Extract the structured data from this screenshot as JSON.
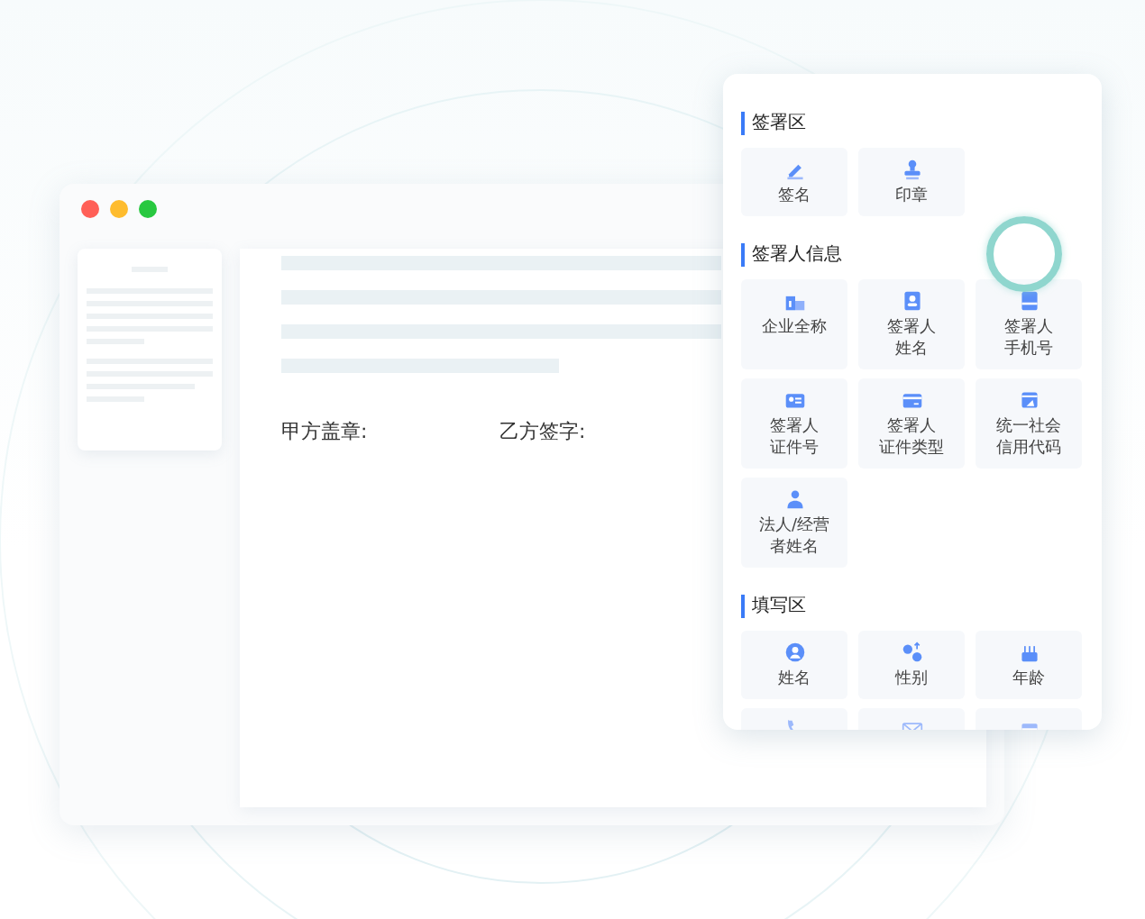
{
  "document": {
    "signature_fields": [
      {
        "label": "甲方盖章:"
      },
      {
        "label": "乙方签字:"
      }
    ]
  },
  "panel": {
    "sections": [
      {
        "title": "签署区",
        "items": [
          {
            "kind": "tile",
            "label": "签名"
          },
          {
            "kind": "tile",
            "label": "印章"
          }
        ]
      },
      {
        "title": "签署人信息",
        "items": [
          {
            "kind": "tile",
            "label": "企业全称"
          },
          {
            "kind": "tile",
            "lines": [
              "签署人",
              "姓名"
            ]
          },
          {
            "kind": "tile",
            "lines": [
              "签署人",
              "手机号"
            ]
          },
          {
            "kind": "tile",
            "lines": [
              "签署人",
              "证件号"
            ]
          },
          {
            "kind": "tile",
            "lines": [
              "签署人",
              "证件类型"
            ]
          },
          {
            "kind": "tile",
            "lines": [
              "统一社会",
              "信用代码"
            ]
          },
          {
            "kind": "tile",
            "lines": [
              "法人/经营",
              "者姓名"
            ]
          }
        ]
      },
      {
        "title": "填写区",
        "items": [
          {
            "kind": "tile",
            "label": "姓名"
          },
          {
            "kind": "tile",
            "label": "性别"
          },
          {
            "kind": "tile",
            "label": "年龄"
          },
          {
            "kind": "clipped"
          },
          {
            "kind": "clipped"
          },
          {
            "kind": "clipped"
          }
        ]
      }
    ]
  }
}
